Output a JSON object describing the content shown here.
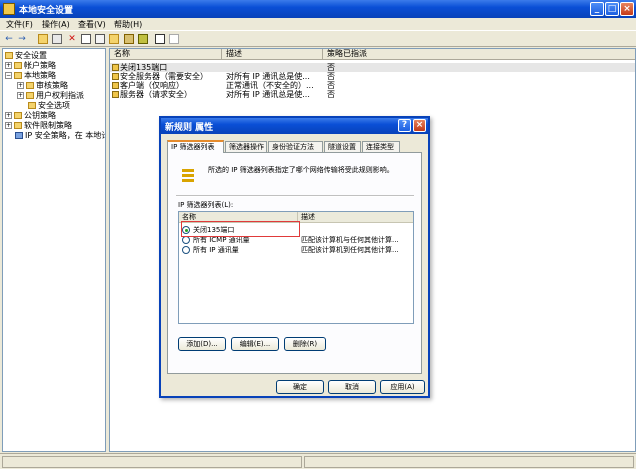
{
  "window": {
    "title": "本地安全设置",
    "min": "_",
    "max": "□",
    "close": "×"
  },
  "menu": [
    "文件(F)",
    "操作(A)",
    "查看(V)",
    "帮助(H)"
  ],
  "toolbar": {
    "back": "←",
    "forward": "→",
    "delete": "✕"
  },
  "tree": {
    "items": [
      {
        "label": "安全设置",
        "pm": ""
      },
      {
        "label": "帐户策略",
        "pm": "+"
      },
      {
        "label": "本地策略",
        "pm": "−"
      },
      {
        "label": "审核策略",
        "pm": "+"
      },
      {
        "label": "用户权利指派",
        "pm": "+"
      },
      {
        "label": "安全选项",
        "pm": ""
      },
      {
        "label": "公钥策略",
        "pm": "+"
      },
      {
        "label": "软件限制策略",
        "pm": "+"
      },
      {
        "label": "IP 安全策略，在 本地计",
        "pm": ""
      }
    ]
  },
  "list": {
    "headers": [
      "名称",
      "描述",
      "策略已指派"
    ],
    "rows": [
      {
        "name": "关闭135端口",
        "desc": "",
        "assigned": "否"
      },
      {
        "name": "安全服务器（需要安全）",
        "desc": "对所有 IP 通讯总是使...",
        "assigned": "否"
      },
      {
        "name": "客户端（仅响应）",
        "desc": "正常通讯（不安全的）...",
        "assigned": "否"
      },
      {
        "name": "服务器（请求安全）",
        "desc": "对所有 IP 通讯总是使...",
        "assigned": "否"
      }
    ]
  },
  "dialog": {
    "title": "新规则 属性",
    "help": "?",
    "close": "×",
    "tabs": [
      "IP 筛选器列表",
      "筛选器操作",
      "身份验证方法",
      "隧道设置",
      "连接类型"
    ],
    "description": "所选的 IP 筛选器列表指定了哪个网络传输将受此规则影响。",
    "list_label": "IP 筛选器列表(L):",
    "columns": [
      "名称",
      "描述"
    ],
    "filters": [
      {
        "name": "关闭135端口",
        "desc": "",
        "selected": true
      },
      {
        "name": "所有 ICMP 通讯量",
        "desc": "匹配该计算机与任何其他计算...",
        "selected": false
      },
      {
        "name": "所有 IP 通讯量",
        "desc": "匹配该计算机到任何其他计算...",
        "selected": false
      }
    ],
    "buttons": {
      "add": "添加(D)...",
      "edit": "编辑(E)...",
      "remove": "删除(R)",
      "ok": "确定",
      "cancel": "取消",
      "apply": "应用(A)"
    }
  }
}
